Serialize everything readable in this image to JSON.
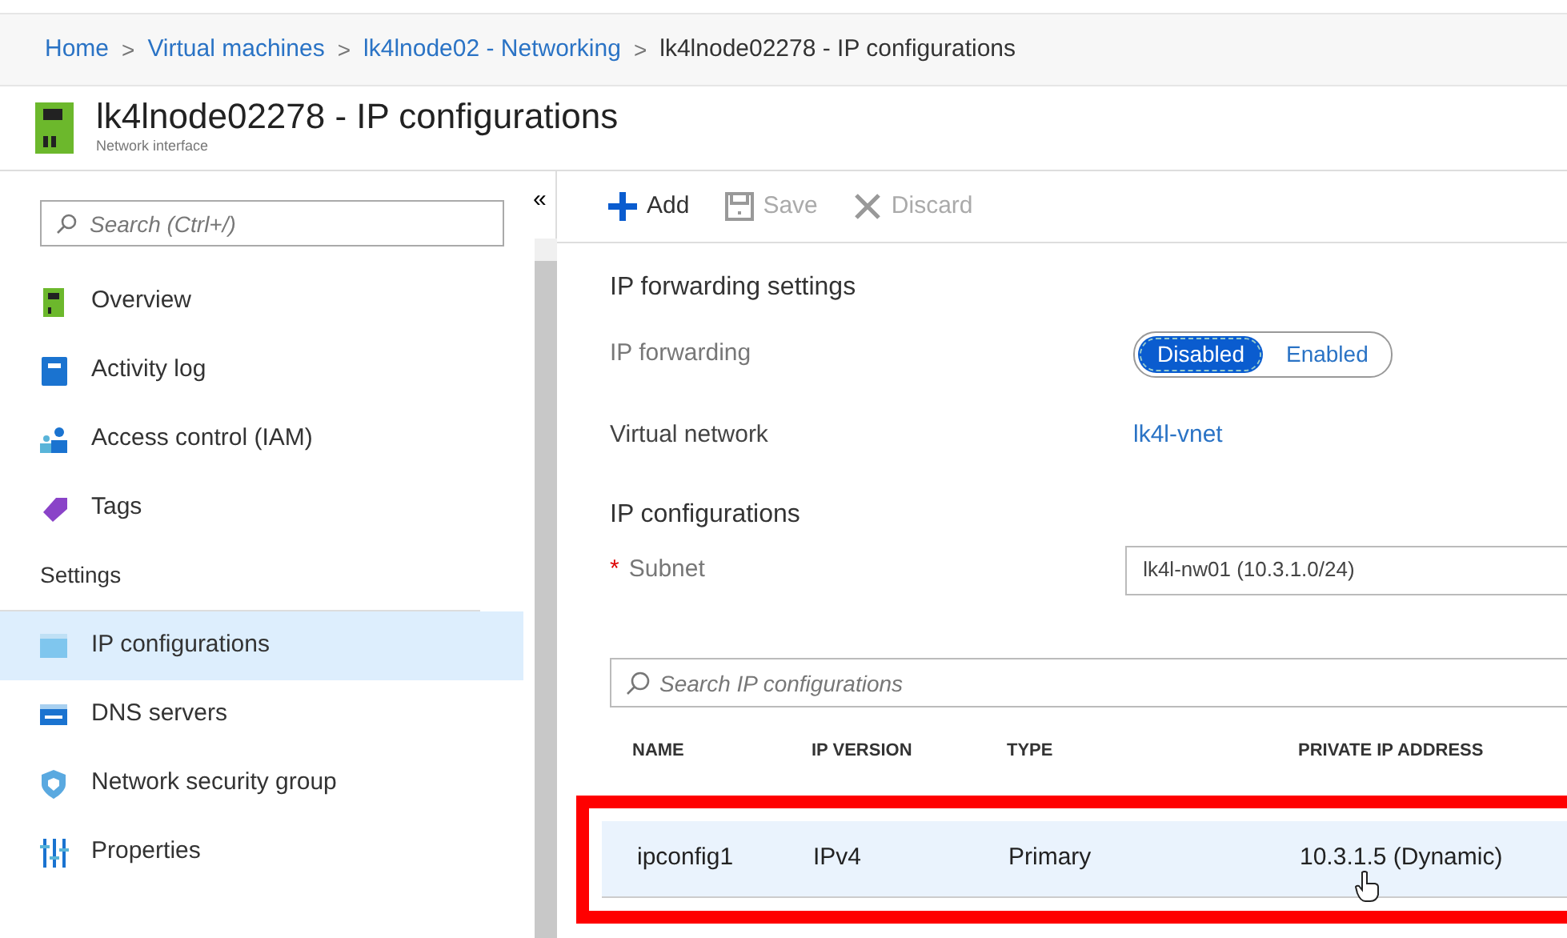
{
  "breadcrumb": [
    {
      "label": "Home",
      "link": true
    },
    {
      "separator": ">",
      "label": "Virtual machines",
      "link": true
    },
    {
      "separator": ">",
      "label": "lk4lnode02 - Networking",
      "link": true
    },
    {
      "separator": ">",
      "label": "lk4lnode02278 - IP configurations",
      "link": false
    }
  ],
  "header": {
    "title": "lk4lnode02278 - IP configurations",
    "subtitle": "Network interface"
  },
  "sidebar": {
    "search": {
      "placeholder": "Search (Ctrl+/)"
    },
    "collapse": "«",
    "items": [
      {
        "kind": "item",
        "label": "Overview",
        "selected": false
      },
      {
        "kind": "item",
        "label": "Activity log",
        "selected": false
      },
      {
        "kind": "item",
        "label": "Access control (IAM)",
        "selected": false
      },
      {
        "kind": "item",
        "label": "Tags",
        "selected": false
      },
      {
        "kind": "heading",
        "label": "Settings"
      },
      {
        "kind": "item",
        "label": "IP configurations",
        "selected": true
      },
      {
        "kind": "item",
        "label": "DNS servers",
        "selected": false
      },
      {
        "kind": "item",
        "label": "Network security group",
        "selected": false
      },
      {
        "kind": "item",
        "label": "Properties",
        "selected": false
      }
    ]
  },
  "toolbar": [
    {
      "label": "Add",
      "disabled": false
    },
    {
      "label": "Save",
      "disabled": true
    },
    {
      "label": "Discard",
      "disabled": true
    }
  ],
  "forwarding": {
    "heading": "IP forwarding settings",
    "label": "IP forwarding",
    "options": [
      {
        "label": "Disabled",
        "selected": true
      },
      {
        "label": "Enabled",
        "selected": false
      }
    ]
  },
  "virtual_network": {
    "label": "Virtual network",
    "value": "lk4l-vnet"
  },
  "ip_configurations": {
    "heading": "IP configurations",
    "subnet": {
      "label": "Subnet",
      "required_mark": "*",
      "value": "lk4l-nw01 (10.3.1.0/24)"
    },
    "search": {
      "placeholder": "Search IP configurations"
    },
    "table": {
      "columns": [
        "NAME",
        "IP VERSION",
        "TYPE",
        "PRIVATE IP ADDRESS"
      ],
      "rows": [
        {
          "cells": [
            "ipconfig1",
            "IPv4",
            "Primary",
            "10.3.1.5 (Dynamic)"
          ],
          "highlighted": true
        }
      ]
    }
  }
}
